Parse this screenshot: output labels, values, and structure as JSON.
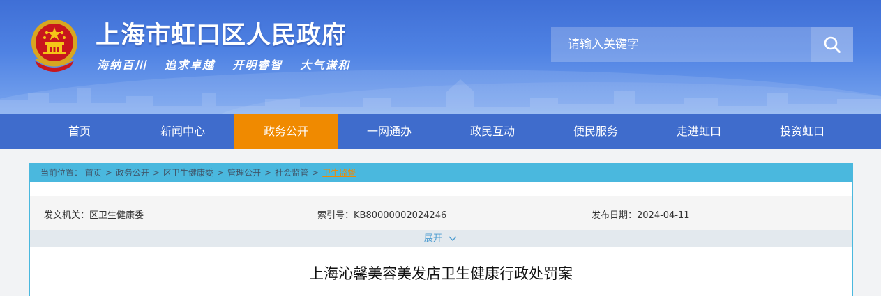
{
  "header": {
    "title": "上海市虹口区人民政府",
    "slogans": [
      "海纳百川",
      "追求卓越",
      "开明睿智",
      "大气谦和"
    ],
    "emblem_icon": "national-emblem-icon",
    "search_placeholder": "请输入关键字",
    "search_icon": "search-icon"
  },
  "nav": {
    "items": [
      "首页",
      "新闻中心",
      "政务公开",
      "一网通办",
      "政民互动",
      "便民服务",
      "走进虹口",
      "投资虹口"
    ],
    "active": "政务公开"
  },
  "breadcrumb": {
    "label": "当前位置：",
    "items": [
      "首页",
      "政务公开",
      "区卫生健康委",
      "管理公开",
      "社会监管",
      "卫生监督"
    ],
    "separator": ">"
  },
  "meta": {
    "issuer_label": "发文机关：区卫生健康委",
    "index_label": "索引号：KB80000002024246",
    "date_label": "发布日期：2024-04-11"
  },
  "expand": {
    "label": "展开",
    "icon": "chevron-down-icon"
  },
  "document": {
    "title": "上海沁馨美容美发店卫生健康行政处罚案"
  },
  "colors": {
    "nav_bg": "#3f6ccc",
    "nav_active": "#f08a00",
    "crumb_bg": "#4ab8de",
    "header_top": "#3f6fd6"
  }
}
